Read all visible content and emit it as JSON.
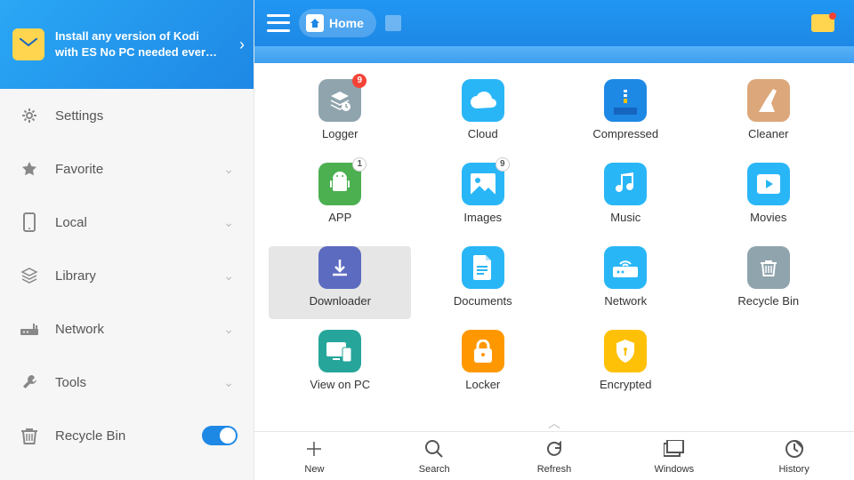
{
  "promo": {
    "line1": "Install any version of Kodi",
    "line2": "with ES No PC needed ever…"
  },
  "sidebar": {
    "items": [
      {
        "label": "Settings",
        "icon": "gear",
        "expandable": false
      },
      {
        "label": "Favorite",
        "icon": "star",
        "expandable": true
      },
      {
        "label": "Local",
        "icon": "phone",
        "expandable": true
      },
      {
        "label": "Library",
        "icon": "stack",
        "expandable": true
      },
      {
        "label": "Network",
        "icon": "router",
        "expandable": true
      },
      {
        "label": "Tools",
        "icon": "wrench",
        "expandable": true
      },
      {
        "label": "Recycle Bin",
        "icon": "trash",
        "expandable": false,
        "toggle": true
      }
    ]
  },
  "header": {
    "home": "Home"
  },
  "tiles": [
    {
      "label": "Logger",
      "bg": "#90a4ae",
      "icon": "stack-clock",
      "badge": "9",
      "badgeStyle": "red"
    },
    {
      "label": "Cloud",
      "bg": "#29b6f6",
      "icon": "cloud"
    },
    {
      "label": "Compressed",
      "bg": "#1e88e5",
      "icon": "zip"
    },
    {
      "label": "Cleaner",
      "bg": "#dca77a",
      "icon": "broom"
    },
    {
      "label": "APP",
      "bg": "#4caf50",
      "icon": "android",
      "badge": "1",
      "badgeStyle": "grey"
    },
    {
      "label": "Images",
      "bg": "#29b6f6",
      "icon": "image",
      "badge": "9",
      "badgeStyle": "grey"
    },
    {
      "label": "Music",
      "bg": "#29b6f6",
      "icon": "music"
    },
    {
      "label": "Movies",
      "bg": "#29b6f6",
      "icon": "play"
    },
    {
      "label": "Downloader",
      "bg": "#5c6bc0",
      "icon": "download",
      "selected": true
    },
    {
      "label": "Documents",
      "bg": "#29b6f6",
      "icon": "doc"
    },
    {
      "label": "Network",
      "bg": "#29b6f6",
      "icon": "wifi"
    },
    {
      "label": "Recycle Bin",
      "bg": "#90a4ae",
      "icon": "trash"
    },
    {
      "label": "View on PC",
      "bg": "#26a69a",
      "icon": "devices"
    },
    {
      "label": "Locker",
      "bg": "#ff9800",
      "icon": "lock"
    },
    {
      "label": "Encrypted",
      "bg": "#ffc107",
      "icon": "shield"
    }
  ],
  "toolbar": [
    {
      "label": "New",
      "icon": "plus"
    },
    {
      "label": "Search",
      "icon": "search"
    },
    {
      "label": "Refresh",
      "icon": "refresh"
    },
    {
      "label": "Windows",
      "icon": "windows"
    },
    {
      "label": "History",
      "icon": "history"
    }
  ]
}
